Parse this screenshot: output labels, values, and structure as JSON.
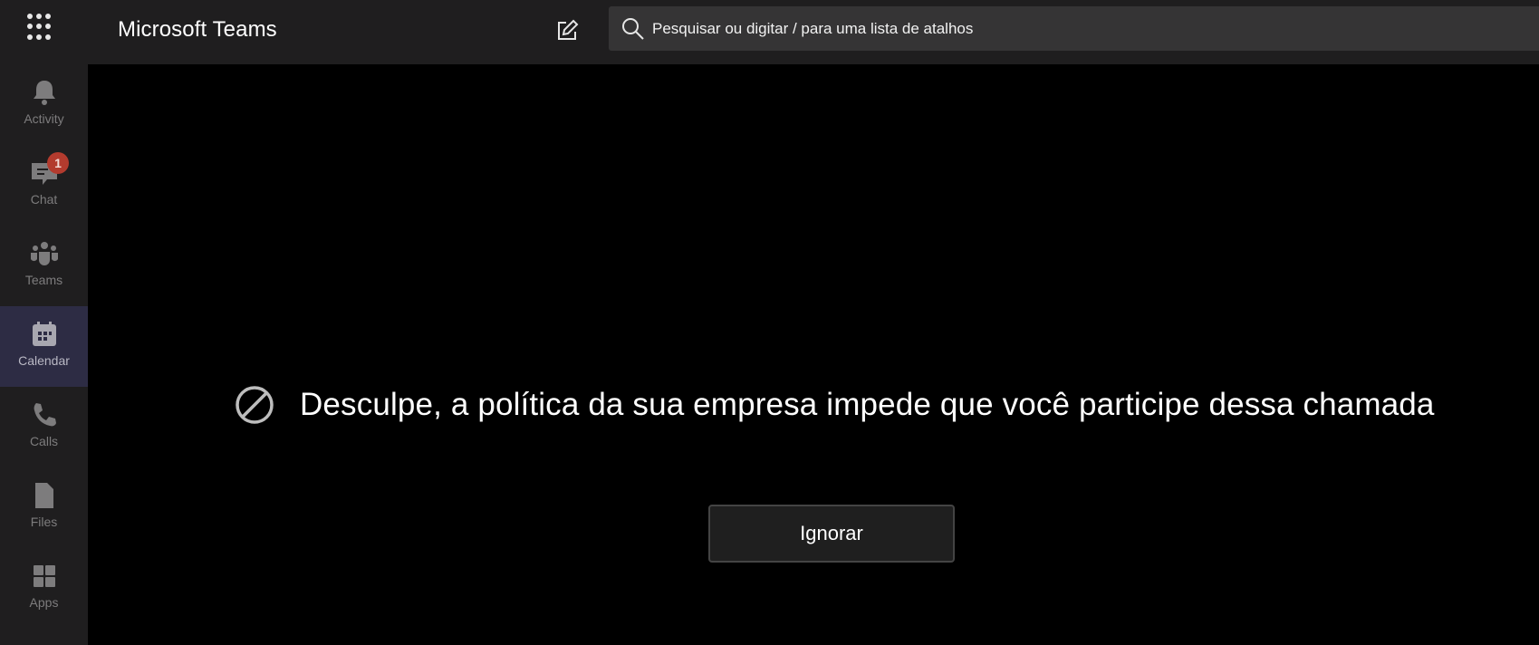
{
  "header": {
    "app_title": "Microsoft Teams",
    "waffle_icon": "app-launcher-icon",
    "compose_icon": "new-chat-icon",
    "search": {
      "placeholder": "Pesquisar ou digitar / para uma lista de atalhos",
      "value": "",
      "icon": "search-icon"
    }
  },
  "sidebar": {
    "items": [
      {
        "label": "Activity",
        "icon": "bell-icon",
        "active": false
      },
      {
        "label": "Chat",
        "icon": "chat-icon",
        "active": false,
        "badge": "1"
      },
      {
        "label": "Teams",
        "icon": "teams-icon",
        "active": false
      },
      {
        "label": "Calendar",
        "icon": "calendar-icon",
        "active": true
      },
      {
        "label": "Calls",
        "icon": "phone-icon",
        "active": false
      },
      {
        "label": "Files",
        "icon": "file-icon",
        "active": false
      },
      {
        "label": "Apps",
        "icon": "apps-icon",
        "active": false
      }
    ]
  },
  "main": {
    "message": "Desculpe, a política da sua empresa impede que você participe dessa chamada",
    "message_icon": "blocked-icon",
    "dismiss_label": "Ignorar"
  },
  "colors": {
    "header_bg": "#1f1e1f",
    "sidebar_active_bg": "#2d2c44",
    "badge": "#b33b2e",
    "main_bg": "#000000"
  }
}
